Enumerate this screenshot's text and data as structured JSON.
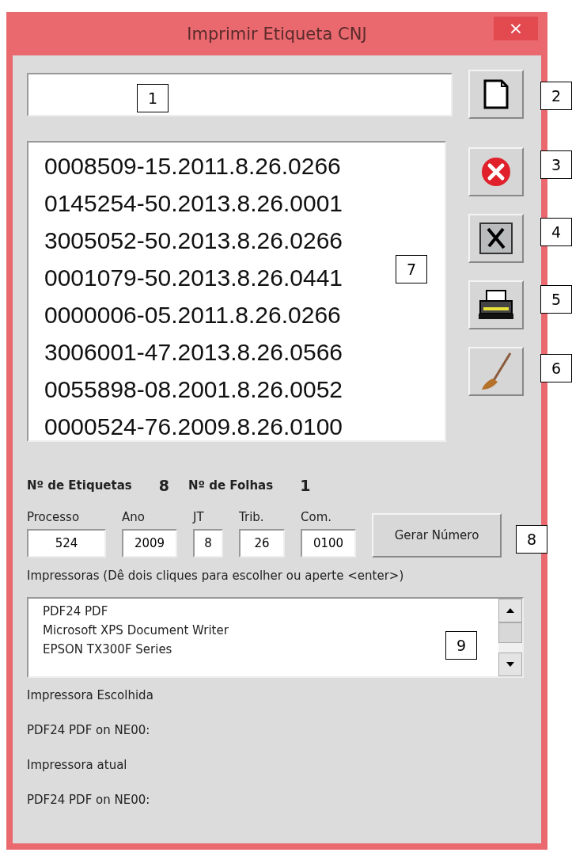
{
  "window": {
    "title": "Imprimir Etiqueta CNJ",
    "close": "×"
  },
  "processos": [
    "0008509-15.2011.8.26.0266",
    "0145254-50.2013.8.26.0001",
    "3005052-50.2013.8.26.0266",
    "0001079-50.2013.8.26.0441",
    "0000006-05.2011.8.26.0266",
    "3006001-47.2013.8.26.0566",
    "0055898-08.2001.8.26.0052",
    "0000524-76.2009.8.26.0100"
  ],
  "counts": [
    {
      "label": "Nº de Etiquetas",
      "value": "8"
    },
    {
      "label": "Nº de Folhas",
      "value": "1"
    }
  ],
  "fields": [
    {
      "label": "Processo",
      "value": "524"
    },
    {
      "label": "Ano",
      "value": "2009"
    },
    {
      "label": "JT",
      "value": "8"
    },
    {
      "label": "Trib.",
      "value": "26"
    },
    {
      "label": "Com.",
      "value": "0100"
    }
  ],
  "gerar_button": "Gerar Número",
  "impressoras_label": "Impressoras (Dê dois cliques para escolher ou aperte <enter>)",
  "impressoras": [
    "PDF24 PDF",
    "Microsoft XPS Document Writer",
    "EPSON TX300F Series"
  ],
  "info": [
    "Impressora Escolhida",
    "PDF24 PDF on NE00:",
    "Impressora atual",
    "PDF24 PDF on NE00:"
  ],
  "callouts": [
    "1",
    "2",
    "3",
    "4",
    "5",
    "6",
    "7",
    "8",
    "9"
  ]
}
